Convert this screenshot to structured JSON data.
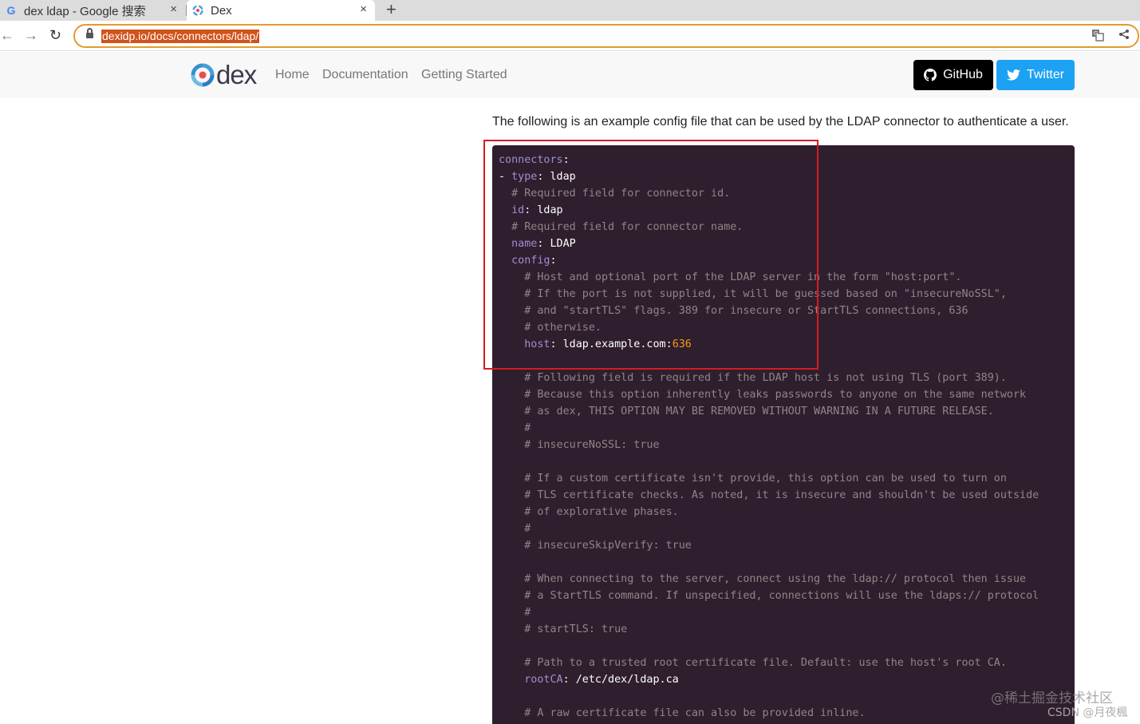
{
  "browser": {
    "tabs": [
      {
        "title": "dex ldap - Google 搜索",
        "icon": "google-icon"
      },
      {
        "title": "Dex",
        "icon": "dex-icon"
      }
    ],
    "close_glyph": "×",
    "new_tab_glyph": "+",
    "url": "dexidp.io/docs/connectors/ldap/",
    "nav_glyphs": {
      "back": "←",
      "forward": "→",
      "reload": "↻"
    }
  },
  "site": {
    "logo_text": "dex",
    "nav": [
      "Home",
      "Documentation",
      "Getting Started"
    ],
    "github_label": "GitHub",
    "twitter_label": "Twitter",
    "colors": {
      "github_bg": "#000000",
      "twitter_bg": "#1da1f2",
      "code_bg": "#2f1e2e",
      "highlight_box": "#d71c1c"
    }
  },
  "content": {
    "intro": "The following is an example config file that can be used by the LDAP connector to authenticate a user.",
    "code_lines": [
      [
        {
          "t": "connectors",
          "c": "key"
        },
        {
          "t": ":",
          "c": "txt"
        }
      ],
      [
        {
          "t": "- ",
          "c": "txt"
        },
        {
          "t": "type",
          "c": "key"
        },
        {
          "t": ": ldap",
          "c": "txt"
        }
      ],
      [
        {
          "t": "  # Required field for connector id.",
          "c": "com"
        }
      ],
      [
        {
          "t": "  ",
          "c": "txt"
        },
        {
          "t": "id",
          "c": "key"
        },
        {
          "t": ": ldap",
          "c": "txt"
        }
      ],
      [
        {
          "t": "  # Required field for connector name.",
          "c": "com"
        }
      ],
      [
        {
          "t": "  ",
          "c": "txt"
        },
        {
          "t": "name",
          "c": "key"
        },
        {
          "t": ": LDAP",
          "c": "txt"
        }
      ],
      [
        {
          "t": "  ",
          "c": "txt"
        },
        {
          "t": "config",
          "c": "key"
        },
        {
          "t": ":",
          "c": "txt"
        }
      ],
      [
        {
          "t": "    # Host and optional port of the LDAP server in the form \"host:port\".",
          "c": "com"
        }
      ],
      [
        {
          "t": "    # If the port is not supplied, it will be guessed based on \"insecureNoSSL\",",
          "c": "com"
        }
      ],
      [
        {
          "t": "    # and \"startTLS\" flags. 389 for insecure or StartTLS connections, 636",
          "c": "com"
        }
      ],
      [
        {
          "t": "    # otherwise.",
          "c": "com"
        }
      ],
      [
        {
          "t": "    ",
          "c": "txt"
        },
        {
          "t": "host",
          "c": "key"
        },
        {
          "t": ": ldap.example.com:",
          "c": "txt"
        },
        {
          "t": "636",
          "c": "num"
        }
      ],
      [
        {
          "t": "",
          "c": "txt"
        }
      ],
      [
        {
          "t": "    # Following field is required if the LDAP host is not using TLS (port 389).",
          "c": "com"
        }
      ],
      [
        {
          "t": "    # Because this option inherently leaks passwords to anyone on the same network",
          "c": "com"
        }
      ],
      [
        {
          "t": "    # as dex, THIS OPTION MAY BE REMOVED WITHOUT WARNING IN A FUTURE RELEASE.",
          "c": "com"
        }
      ],
      [
        {
          "t": "    #",
          "c": "com"
        }
      ],
      [
        {
          "t": "    # insecureNoSSL: true",
          "c": "com"
        }
      ],
      [
        {
          "t": "",
          "c": "txt"
        }
      ],
      [
        {
          "t": "    # If a custom certificate isn't provide, this option can be used to turn on",
          "c": "com"
        }
      ],
      [
        {
          "t": "    # TLS certificate checks. As noted, it is insecure and shouldn't be used outside",
          "c": "com"
        }
      ],
      [
        {
          "t": "    # of explorative phases.",
          "c": "com"
        }
      ],
      [
        {
          "t": "    #",
          "c": "com"
        }
      ],
      [
        {
          "t": "    # insecureSkipVerify: true",
          "c": "com"
        }
      ],
      [
        {
          "t": "",
          "c": "txt"
        }
      ],
      [
        {
          "t": "    # When connecting to the server, connect using the ldap:// protocol then issue",
          "c": "com"
        }
      ],
      [
        {
          "t": "    # a StartTLS command. If unspecified, connections will use the ldaps:// protocol",
          "c": "com"
        }
      ],
      [
        {
          "t": "    #",
          "c": "com"
        }
      ],
      [
        {
          "t": "    # startTLS: true",
          "c": "com"
        }
      ],
      [
        {
          "t": "",
          "c": "txt"
        }
      ],
      [
        {
          "t": "    # Path to a trusted root certificate file. Default: use the host's root CA.",
          "c": "com"
        }
      ],
      [
        {
          "t": "    ",
          "c": "txt"
        },
        {
          "t": "rootCA",
          "c": "key"
        },
        {
          "t": ": /etc/dex/ldap.ca",
          "c": "txt"
        }
      ],
      [
        {
          "t": "",
          "c": "txt"
        }
      ],
      [
        {
          "t": "    # A raw certificate file can also be provided inline.",
          "c": "com"
        }
      ]
    ]
  },
  "watermarks": [
    "@稀土掘金技术社区",
    "CSDN @月夜楓"
  ]
}
